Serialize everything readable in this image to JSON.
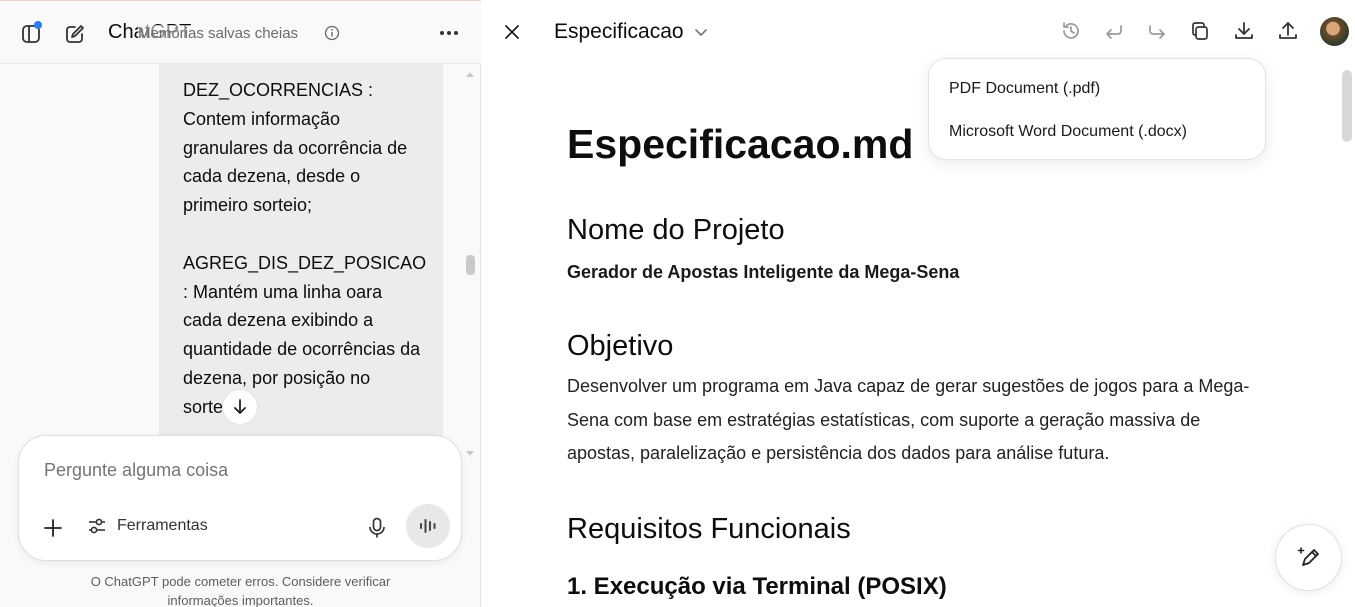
{
  "sidebar": {
    "brand": "ChatGPT",
    "memory_notice": "Memórias salvas cheias",
    "icons": {
      "toggle": "sidebar-toggle-icon",
      "new_chat": "new-chat-icon",
      "info": "info-icon",
      "more": "more-icon"
    }
  },
  "message": {
    "text": "DEZ_OCORRENCIAS :\nContem informação granulares da ocorrência de cada dezena, desde o primeiro sorteio;\n\nAGREG_DIS_DEZ_POSICAO : Mantém uma linha oara cada dezena exibindo a quantidade de ocorrências da dezena, por posição no sorteio"
  },
  "composer": {
    "placeholder": "Pergunte alguma coisa",
    "tools_label": "Ferramentas"
  },
  "disclaimer": "O ChatGPT pode cometer erros. Considere verificar informações importantes.",
  "canvas": {
    "doc_title": "Especificacao",
    "toolbar_icons": [
      "history-icon",
      "undo-icon",
      "redo-icon",
      "copy-icon",
      "download-icon",
      "share-icon"
    ],
    "download_menu": [
      "PDF Document (.pdf)",
      "Microsoft Word Document (.docx)"
    ]
  },
  "document": {
    "h1": "Especificacao.md",
    "h2_project": "Nome do Projeto",
    "project_name": "Gerador de Apostas Inteligente da Mega-Sena",
    "h2_objective": "Objetivo",
    "objective": "Desenvolver um programa em Java capaz de gerar sugestões de jogos para a Mega-Sena com base em estratégias estatísticas, com suporte a geração massiva de apostas, paralelização e persistência dos dados para análise futura.",
    "h2_requirements": "Requisitos Funcionais",
    "req_1": "1. Execução via Terminal (POSIX)"
  }
}
